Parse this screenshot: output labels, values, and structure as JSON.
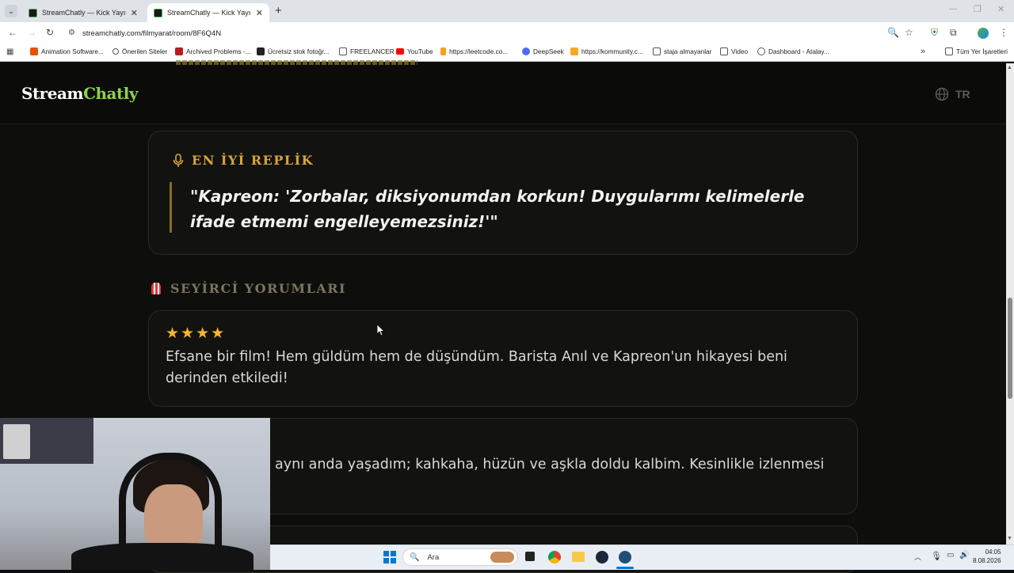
{
  "browser": {
    "tabs": [
      {
        "title": "StreamChatly — Kick Yayıncıları",
        "active": false
      },
      {
        "title": "StreamChatly — Kick Yayıncıları",
        "active": true
      }
    ],
    "new_tab": "+",
    "url": "streamchatly.com/filmyarat/room/8F6Q4N",
    "bookmarks": [
      {
        "label": "Animation Software...",
        "icon": "v-icon",
        "color": "#e65100"
      },
      {
        "label": "Önerilen Siteler",
        "icon": "search-icon",
        "color": "#555555"
      },
      {
        "label": "Archived Problems -...",
        "icon": "pe-icon",
        "color": "#b71c1c"
      },
      {
        "label": "Ücretsiz stok fotoğr...",
        "icon": "camera-icon",
        "color": "#222222"
      },
      {
        "label": "FREELANCER",
        "icon": "folder-icon",
        "color": "#555555"
      },
      {
        "label": "YouTube",
        "icon": "youtube-icon",
        "color": "#ff0000"
      },
      {
        "label": "https://leetcode.co...",
        "icon": "leetcode-icon",
        "color": "#f89f1b"
      },
      {
        "label": "DeepSeek",
        "icon": "deepseek-icon",
        "color": "#4d6bfe"
      },
      {
        "label": "https://kommunity.c...",
        "icon": "k-icon",
        "color": "#f9a825"
      },
      {
        "label": "staja almayanlar",
        "icon": "folder-icon",
        "color": "#555555"
      },
      {
        "label": "Video",
        "icon": "folder-icon",
        "color": "#555555"
      },
      {
        "label": "Dashboard - Atalay...",
        "icon": "globe-icon",
        "color": "#555555"
      }
    ],
    "all_bookmarks": "Tüm Yer İşaretleri"
  },
  "site": {
    "logo_part1": "Stream",
    "logo_part2": "Chatly",
    "lang": "TR",
    "brand_green": "#8fd14f",
    "accent_gold": "#d8a53a"
  },
  "quote": {
    "heading": "EN İYİ REPLİK",
    "text": "\"Kapreon: 'Zorbalar, diksiyonumdan korkun! Duygularımı kelimelerle ifade etmemi engelleyemezsiniz!'\""
  },
  "reviews": {
    "heading": "SEYİRCİ YORUMLARI",
    "items": [
      {
        "rating": 4,
        "stars": "★★★★",
        "text": "Efsane bir film! Hem güldüm hem de düşündüm. Barista Anıl ve Kapreon'un hikayesi beni derinden etkiledi!"
      },
      {
        "text": "aynı anda yaşadım; kahkaha, hüzün ve aşkla doldu kalbim. Kesinlikle izlenmesi"
      }
    ]
  },
  "taskbar": {
    "search_placeholder": "Ara",
    "time": "04:05",
    "date": "8.08.2026"
  }
}
